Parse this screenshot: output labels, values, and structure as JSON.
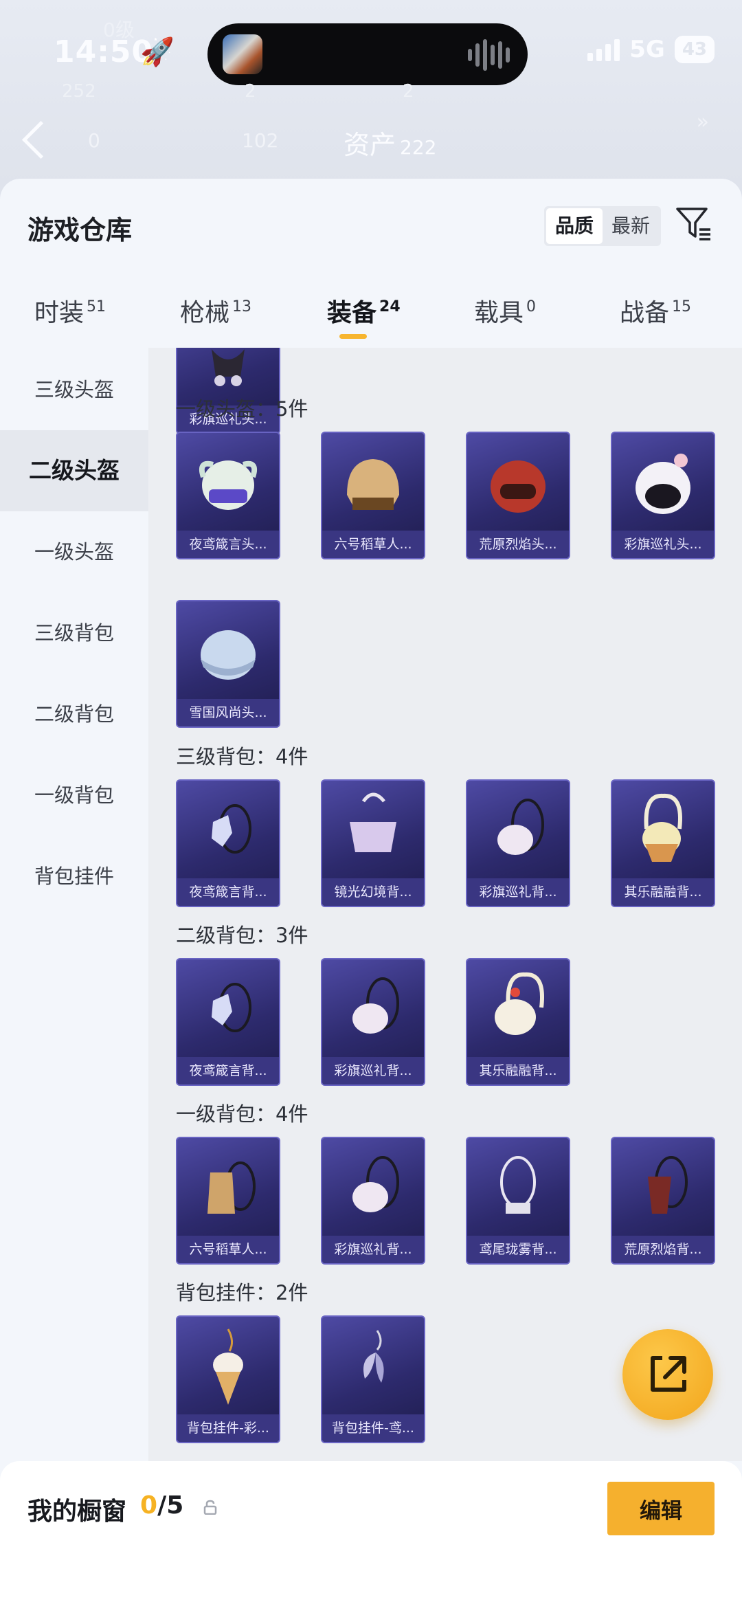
{
  "status_bar": {
    "time": "14:50",
    "network": "5G",
    "battery": "43",
    "faded_top_text": "0级"
  },
  "background_header": {
    "stat_1": "252",
    "stat_2": "2",
    "stat_3": "2",
    "left_value": "0",
    "mid_value": "102",
    "asset_label": "资产",
    "asset_value": "222"
  },
  "sheet": {
    "title": "游戏仓库",
    "sort_options": [
      "品质",
      "最新"
    ],
    "sort_selected": "品质",
    "tabs": [
      {
        "label": "时装",
        "count": "51"
      },
      {
        "label": "枪械",
        "count": "13"
      },
      {
        "label": "装备",
        "count": "24"
      },
      {
        "label": "载具",
        "count": "0"
      },
      {
        "label": "战备",
        "count": "15"
      }
    ],
    "active_tab": "装备",
    "sidebar": [
      "三级头盔",
      "二级头盔",
      "一级头盔",
      "三级背包",
      "二级背包",
      "一级背包",
      "背包挂件"
    ],
    "active_sidebar": "二级头盔",
    "top_partial_card": "彩旗巡礼头...",
    "groups": [
      {
        "title": "一级头盔：5件",
        "items": [
          "夜鸢箴言头...",
          "六号稻草人...",
          "荒原烈焰头...",
          "彩旗巡礼头...",
          "雪国风尚头..."
        ]
      },
      {
        "title": "三级背包：4件",
        "items": [
          "夜鸢箴言背...",
          "镜光幻境背...",
          "彩旗巡礼背...",
          "其乐融融背..."
        ]
      },
      {
        "title": "二级背包：3件",
        "items": [
          "夜鸢箴言背...",
          "彩旗巡礼背...",
          "其乐融融背..."
        ]
      },
      {
        "title": "一级背包：4件",
        "items": [
          "六号稻草人...",
          "彩旗巡礼背...",
          "鸢尾珑雾背...",
          "荒原烈焰背..."
        ]
      },
      {
        "title": "背包挂件：2件",
        "items": [
          "背包挂件-彩...",
          "背包挂件-鸢..."
        ]
      }
    ]
  },
  "showcase": {
    "title": "我的橱窗",
    "current": "0",
    "max": "/5",
    "edit_label": "编辑"
  },
  "colors": {
    "accent": "#f5b02e",
    "card_bg": "#2d2a6d",
    "card_border": "#6863c2"
  }
}
